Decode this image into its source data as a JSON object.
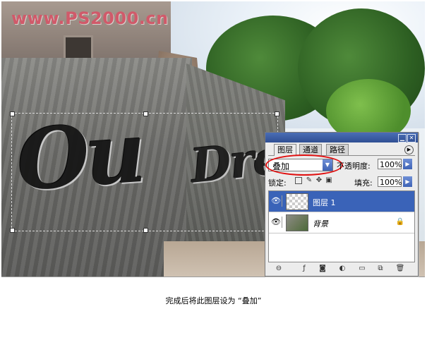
{
  "watermark": "www.PS2000.cn",
  "carved_text": {
    "left": "Ou",
    "right": "Drea"
  },
  "layers_panel": {
    "tabs": [
      "图层",
      "通道",
      "路径"
    ],
    "blend_mode": "叠加",
    "opacity_label": "不透明度:",
    "opacity_value": "100%",
    "lock_label": "锁定:",
    "fill_label": "填充:",
    "fill_value": "100%",
    "layers": [
      {
        "name": "图层 1",
        "selected": true
      },
      {
        "name": "背景",
        "selected": false
      }
    ]
  },
  "caption": "完成后将此图层设为 “叠加”",
  "colors": {
    "highlight_ellipse": "#e01010",
    "selection_blue": "#3a63b8",
    "watermark": "#d05a6a"
  }
}
